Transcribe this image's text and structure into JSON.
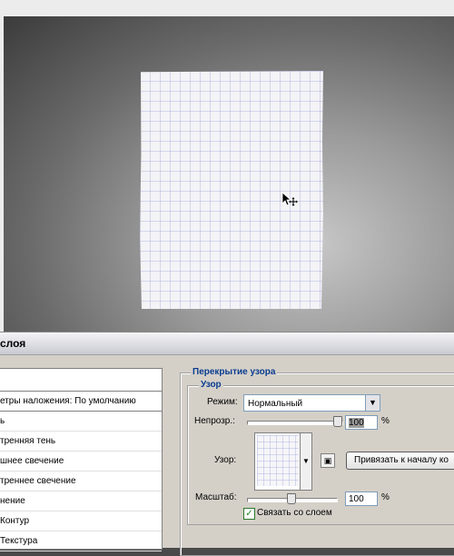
{
  "dialog": {
    "title": "слоя",
    "styles_list": [
      "етры наложения: По умолчанию",
      "ь",
      "тренняя тень",
      "шнее свечение",
      "треннее свечение",
      "нение",
      "Контур",
      "Текстура"
    ],
    "group_outer": "Перекрытие узора",
    "group_inner": "Узор",
    "mode_label": "Режим:",
    "mode_value": "Нормальный",
    "opacity_label": "Непрозр.:",
    "opacity_value": "100",
    "percent": "%",
    "pattern_label": "Узор:",
    "snap_button": "Привязать к началу ко",
    "scale_label": "Масштаб:",
    "scale_value": "100",
    "link_label": "Связать со слоем",
    "link_checked": true,
    "opacity_level_percent": 100,
    "scale_level_percent": 100
  },
  "colors": {
    "legend_blue": "#0a3d91",
    "dialog_bg": "#d4d0c8",
    "grid_line": "#96a0d7"
  },
  "icons": {
    "cursor": "move-cursor-icon",
    "dropdown": "chevron-down-icon",
    "new_pattern": "new-pattern-icon",
    "checkmark": "checkmark-icon"
  }
}
